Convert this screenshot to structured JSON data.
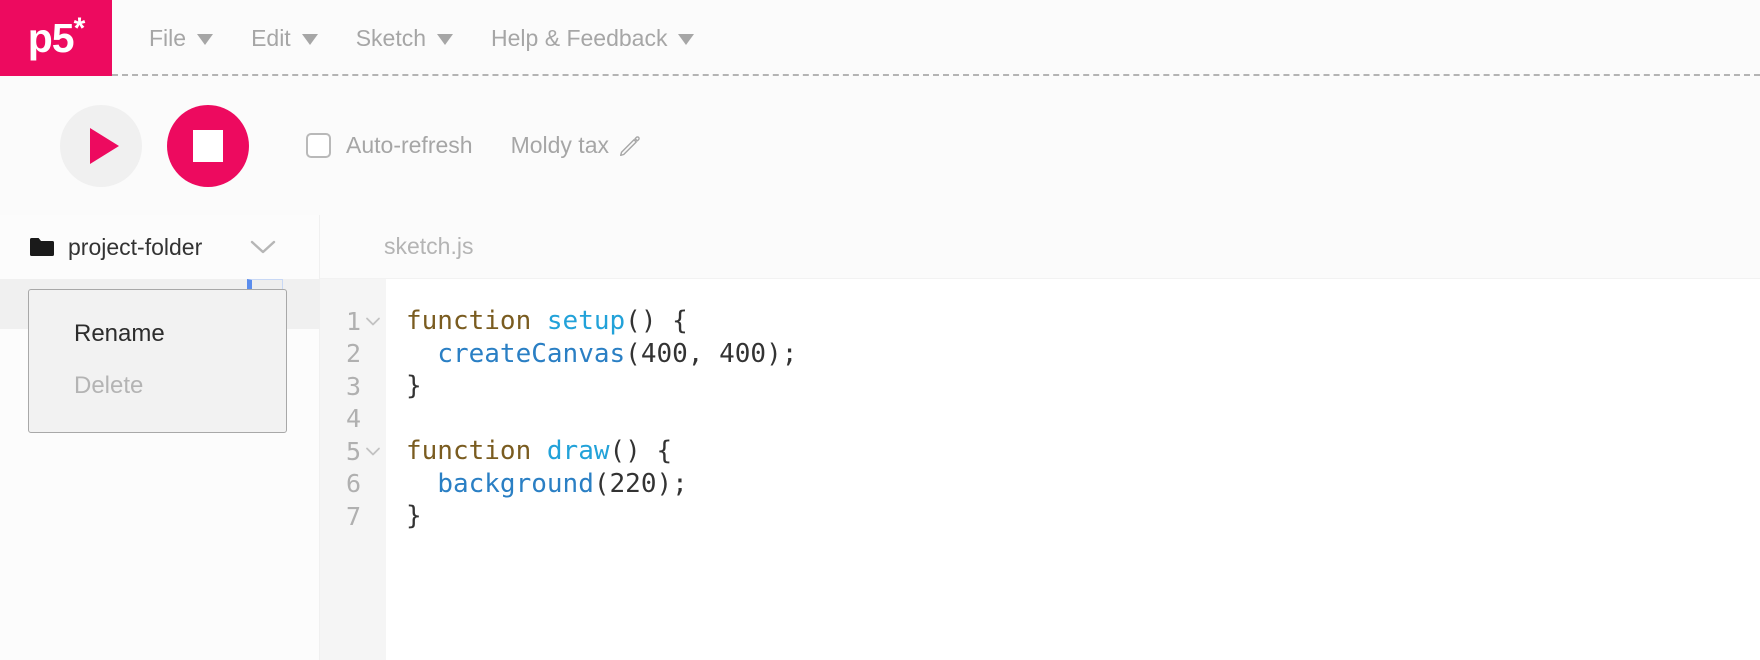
{
  "navbar": {
    "logo_text": "p5",
    "logo_star": "*",
    "menus": [
      {
        "label": "File"
      },
      {
        "label": "Edit"
      },
      {
        "label": "Sketch"
      },
      {
        "label": "Help & Feedback"
      }
    ]
  },
  "toolbar": {
    "play_label": "Play sketch",
    "stop_label": "Stop sketch",
    "autorefresh_label": "Auto-refresh",
    "autorefresh_checked": false,
    "sketch_name": "Moldy tax",
    "edit_name_label": "Edit sketch name"
  },
  "sidebar": {
    "folder_name": "project-folder",
    "files": [
      {
        "name": "sketch.js",
        "selected": true
      }
    ],
    "context_menu": {
      "items": [
        {
          "label": "Rename",
          "disabled": false
        },
        {
          "label": "Delete",
          "disabled": true
        }
      ]
    }
  },
  "editor": {
    "tab_label": "sketch.js",
    "lines": [
      {
        "number": "1",
        "foldable": true,
        "tokens": [
          {
            "t": "function",
            "c": "kw"
          },
          {
            "t": " ",
            "c": "plain"
          },
          {
            "t": "setup",
            "c": "def"
          },
          {
            "t": "() {",
            "c": "plain"
          }
        ]
      },
      {
        "number": "2",
        "foldable": false,
        "tokens": [
          {
            "t": "  ",
            "c": "plain"
          },
          {
            "t": "createCanvas",
            "c": "fn"
          },
          {
            "t": "(",
            "c": "plain"
          },
          {
            "t": "400",
            "c": "num"
          },
          {
            "t": ", ",
            "c": "plain"
          },
          {
            "t": "400",
            "c": "num"
          },
          {
            "t": ");",
            "c": "plain"
          }
        ]
      },
      {
        "number": "3",
        "foldable": false,
        "tokens": [
          {
            "t": "}",
            "c": "plain"
          }
        ]
      },
      {
        "number": "4",
        "foldable": false,
        "tokens": [
          {
            "t": "",
            "c": "plain"
          }
        ]
      },
      {
        "number": "5",
        "foldable": true,
        "tokens": [
          {
            "t": "function",
            "c": "kw"
          },
          {
            "t": " ",
            "c": "plain"
          },
          {
            "t": "draw",
            "c": "def"
          },
          {
            "t": "() {",
            "c": "plain"
          }
        ]
      },
      {
        "number": "6",
        "foldable": false,
        "tokens": [
          {
            "t": "  ",
            "c": "plain"
          },
          {
            "t": "background",
            "c": "fn"
          },
          {
            "t": "(",
            "c": "plain"
          },
          {
            "t": "220",
            "c": "num"
          },
          {
            "t": ");",
            "c": "plain"
          }
        ]
      },
      {
        "number": "7",
        "foldable": false,
        "tokens": [
          {
            "t": "}",
            "c": "plain"
          }
        ]
      }
    ]
  },
  "colors": {
    "brand_pink": "#ed0a5f",
    "focus_blue": "#5b8ded",
    "muted_text": "#a6a6a6",
    "code_keyword": "#7a5c20",
    "code_definition": "#22a2d9",
    "code_function": "#2a7fc4",
    "code_plain": "#333333"
  }
}
